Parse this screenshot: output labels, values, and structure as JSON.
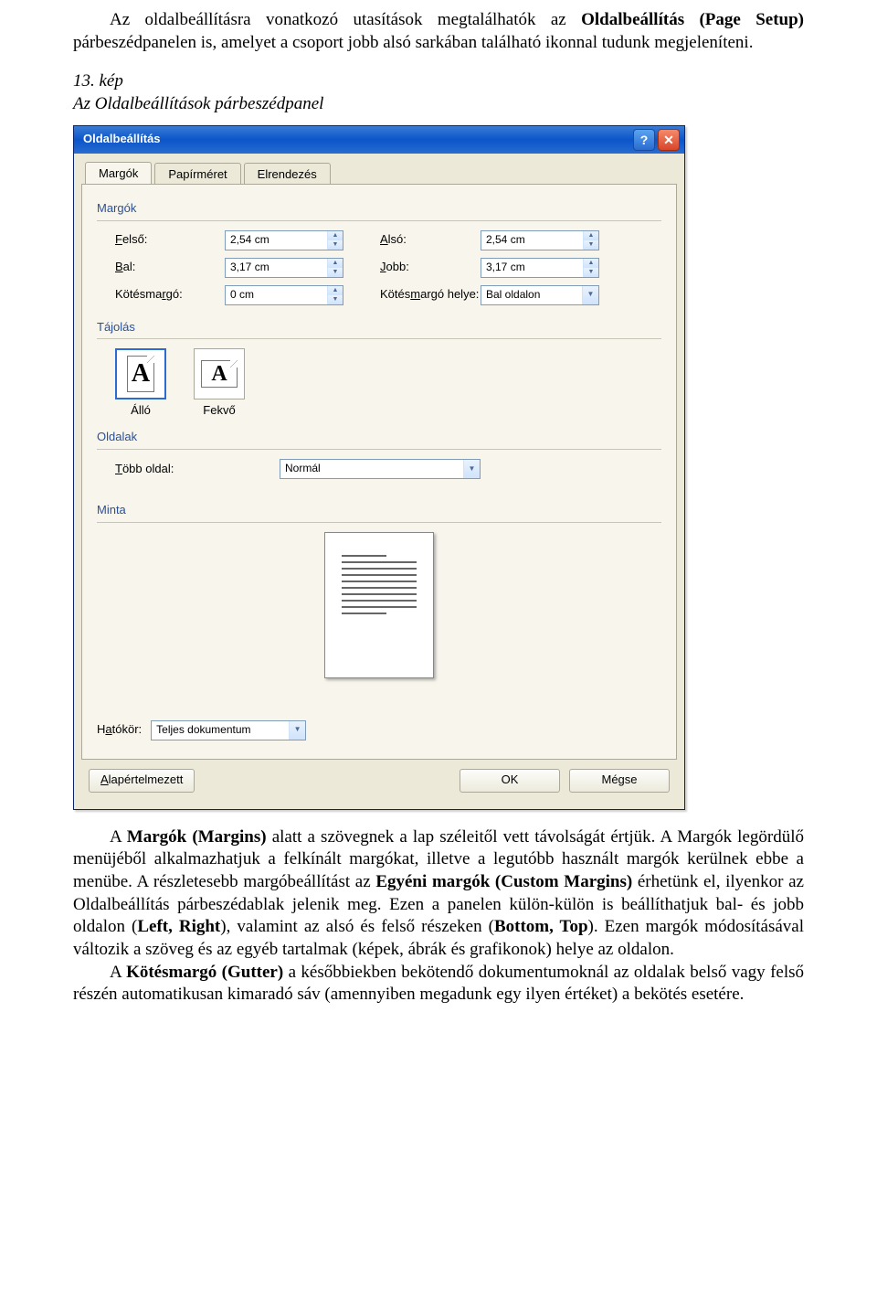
{
  "doc": {
    "para1a": "Az oldalbeállításra vonatkozó utasítások megtalálhatók az ",
    "para1b": "Oldalbeállítás (Page Setup)",
    "para1c": " párbeszédpanelen is, amelyet a csoport jobb alsó sarkában található ikonnal tudunk megjeleníteni.",
    "fig_caption_a": "13. kép",
    "fig_caption_b": "Az Oldalbeállítások párbeszédpanel",
    "para2a": "A ",
    "para2b": "Margók (Margins)",
    "para2c": " alatt a szövegnek a lap széleitől vett távolságát értjük. A Margók legördülő menüjéből alkalmazhatjuk a felkínált margókat, illetve a legutóbb használt margók kerülnek ebbe a menübe. A részletesebb margóbeállítást az ",
    "para2d": "Egyéni margók (Custom Margins)",
    "para2e": " érhetünk el, ilyenkor az Oldalbeállítás párbeszédablak jelenik meg. Ezen a panelen külön-külön is beállíthatjuk bal- és jobb oldalon (",
    "para2f": "Left, Right",
    "para2g": "), valamint az alsó és felső részeken (",
    "para2h": "Bottom, Top",
    "para2i": "). Ezen margók módosításával változik a szöveg és az egyéb tartalmak (képek, ábrák és grafikonok) helye az oldalon.",
    "para3a": "A ",
    "para3b": "Kötésmargó (Gutter)",
    "para3c": " a későbbiekben bekötendő dokumentumoknál az oldalak belső vagy felső részén automatikusan kimaradó sáv (amennyiben megadunk egy ilyen értéket) a bekötés esetére."
  },
  "dialog": {
    "title": "Oldalbeállítás",
    "tabs": [
      "Margók",
      "Papírméret",
      "Elrendezés"
    ],
    "sections": {
      "margins": "Margók",
      "orientation": "Tájolás",
      "pages": "Oldalak",
      "preview": "Minta"
    },
    "labels": {
      "top": "Felső:",
      "bottom": "Alsó:",
      "left": "Bal:",
      "right": "Jobb:",
      "gutter": "Kötésmargó:",
      "gutter_pos": "Kötésmargó helye:",
      "multi": "Több oldal:",
      "scope": "Hatókör:"
    },
    "values": {
      "top": "2,54 cm",
      "bottom": "2,54 cm",
      "left": "3,17 cm",
      "right": "3,17 cm",
      "gutter": "0 cm",
      "gutter_pos": "Bal oldalon",
      "multi": "Normál",
      "scope": "Teljes dokumentum"
    },
    "orientation": {
      "portrait": "Álló",
      "landscape": "Fekvő",
      "glyph": "A"
    },
    "buttons": {
      "default": "Alapértelmezett",
      "ok": "OK",
      "cancel": "Mégse"
    }
  }
}
